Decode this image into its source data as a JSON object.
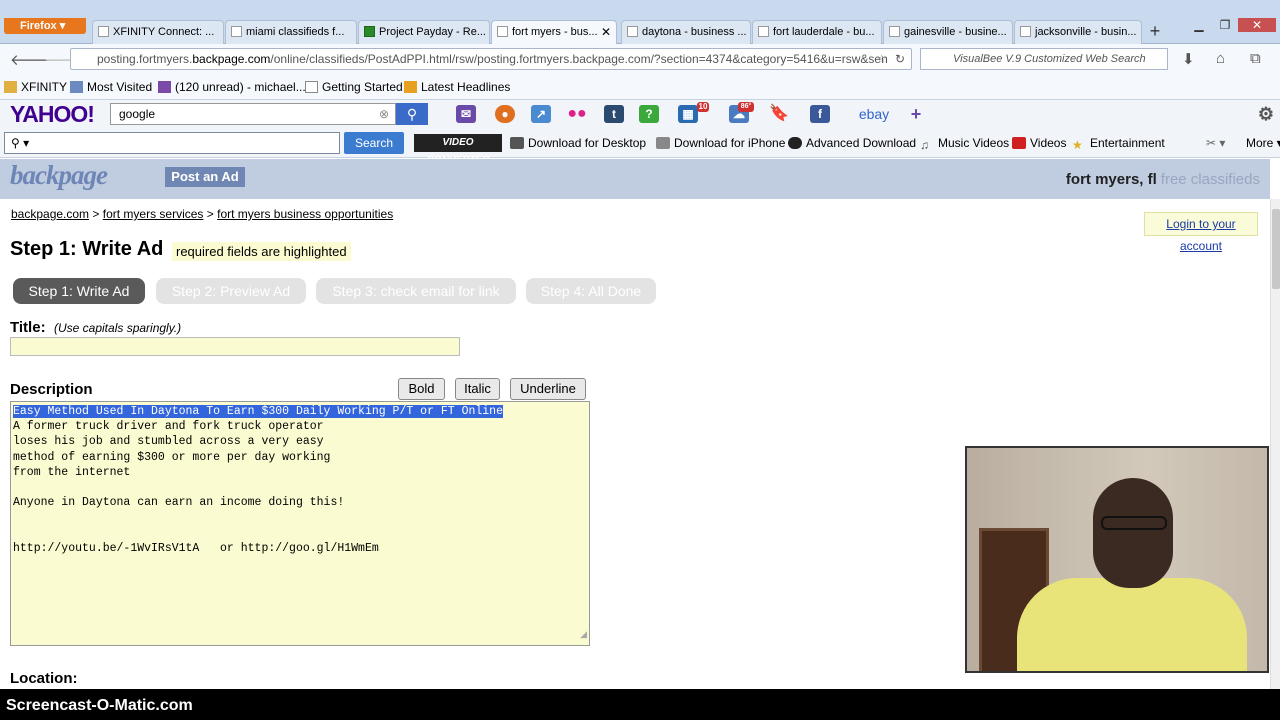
{
  "browser": {
    "menu_label": "Firefox",
    "tabs": [
      {
        "label": "XFINITY Connect: ..."
      },
      {
        "label": "miami classifieds f..."
      },
      {
        "label": "Project Payday - Re..."
      },
      {
        "label": "fort myers - bus..."
      },
      {
        "label": "daytona - business ..."
      },
      {
        "label": "fort lauderdale - bu..."
      },
      {
        "label": "gainesville - busine..."
      },
      {
        "label": "jacksonville - busin..."
      }
    ],
    "new_tab": "+",
    "url_pre": "posting.fortmyers.",
    "url_domain": "backpage.com",
    "url_post": "/online/classifieds/PostAdPPI.html/rsw/posting.fortmyers.backpage.com/?section=4374&category=5416&u=rsw&sen",
    "search_placeholder": "VisualBee V.9 Customized Web Search"
  },
  "bookmarks": [
    "XFINITY",
    "Most Visited",
    "(120 unread) - michael...",
    "Getting Started",
    "Latest Headlines"
  ],
  "yahoo": {
    "logo": "YAHOO!",
    "search_value": "google",
    "badge_1": "10",
    "badge_2": "86°",
    "ebay": "ebay"
  },
  "toolbar": {
    "search_btn": "Search",
    "video_converter": "VIDEO CONVERTER",
    "items": [
      "Download for Desktop",
      "Download for iPhone",
      "Advanced Download",
      "Music Videos",
      "Videos",
      "Entertainment"
    ],
    "more": "More"
  },
  "site": {
    "logo": "backpage",
    "post_ad": "Post an Ad",
    "city": "fort myers, fl",
    "free_classifieds": "free classifieds",
    "breadcrumb": [
      "backpage.com",
      "fort myers services",
      "fort myers business opportunities"
    ],
    "login": "Login to your account"
  },
  "form": {
    "step_title": "Step 1: Write Ad",
    "required_note": "required fields are highlighted",
    "steps": [
      "Step 1: Write Ad",
      "Step 2: Preview Ad",
      "Step 3: check email for link",
      "Step 4: All Done"
    ],
    "title_label": "Title:",
    "title_hint": "(Use capitals sparingly.)",
    "title_value": "",
    "description_label": "Description",
    "bold": "Bold",
    "italic": "Italic",
    "underline": "Underline",
    "description_selected": "Easy Method Used In Daytona To Earn $300 Daily Working P/T or FT Online",
    "description_rest": "A former truck driver and fork truck operator\nloses his job and stumbled across a very easy\nmethod of earning $300 or more per day working\nfrom the internet\n\nAnyone in Daytona can earn an income doing this!\n\n\nhttp://youtu.be/-1WvIRsV1tA   or http://goo.gl/H1WmEm",
    "location_label": "Location:"
  },
  "watermark": "Screencast-O-Matic.com"
}
